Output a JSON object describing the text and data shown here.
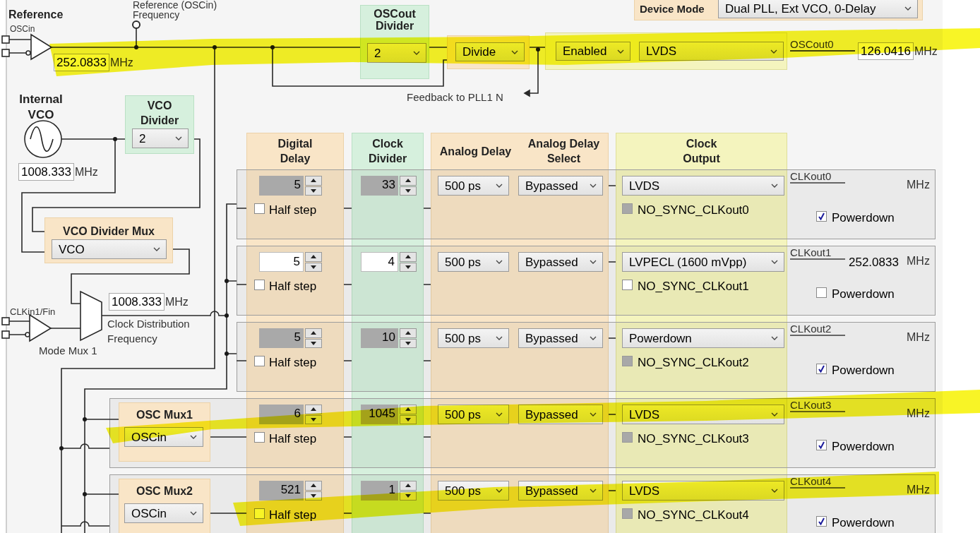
{
  "device_mode": {
    "label": "Device Mode",
    "value": "Dual PLL, Ext VCO, 0-Delay"
  },
  "reference": {
    "title": "Reference",
    "input": "OSCin",
    "probe_label": [
      "Reference (OSCin)",
      "Frequency"
    ],
    "frequency": "252.0833",
    "unit": "MHz"
  },
  "oscout_divider": {
    "title": "OSCout Divider",
    "value": "2"
  },
  "oscout_mux": {
    "value": "Divide"
  },
  "feedback_label": "Feedback to PLL1 N",
  "oscout": {
    "enable": "Enabled",
    "format": "LVDS",
    "name": "OSCout0",
    "frequency": "126.0416",
    "unit": "MHz"
  },
  "internal_vco": {
    "title": "Internal VCO",
    "frequency": "1008.333",
    "unit": "MHz"
  },
  "vco_divider": {
    "title": "VCO Divider",
    "value": "2"
  },
  "vco_divider_mux": {
    "title": "VCO Divider Mux",
    "value": "VCO"
  },
  "mode_mux": {
    "input": "CLKin1/Fin",
    "title": "Mode Mux 1",
    "frequency": "1008.333",
    "unit": "MHz",
    "frequency_label": [
      "Clock Distribution",
      "Frequency"
    ]
  },
  "columns": [
    {
      "labels": [
        "Digital Delay"
      ],
      "kind": "delay"
    },
    {
      "labels": [
        "Clock Divider"
      ],
      "kind": "divider"
    },
    {
      "labels": [
        "Analog Delay",
        "Analog Delay Select"
      ],
      "kind": "delay"
    },
    {
      "labels": [
        "Clock Output"
      ],
      "kind": "output"
    }
  ],
  "rows": [
    {
      "digital_delay": "5",
      "clock_divider": "33",
      "half_step_label": "Half step",
      "half_step": false,
      "analog_delay": "500 ps",
      "analog_select": "Bypassed",
      "format": "LVDS",
      "no_sync_label": "NO_SYNC_CLKout0",
      "disabled": true,
      "name": "CLKout0",
      "unit": "MHz",
      "powerdown_label": "Powerdown",
      "powerdown": true
    },
    {
      "digital_delay": "5",
      "clock_divider": "4",
      "half_step_label": "Half step",
      "half_step": false,
      "analog_delay": "500 ps",
      "analog_select": "Bypassed",
      "format": "LVPECL (1600 mVpp)",
      "no_sync_label": "NO_SYNC_CLKout1",
      "disabled": false,
      "name": "CLKout1",
      "frequency": "252.0833",
      "unit": "MHz",
      "powerdown_label": "Powerdown",
      "powerdown": false
    },
    {
      "digital_delay": "5",
      "clock_divider": "10",
      "half_step_label": "Half step",
      "half_step": false,
      "analog_delay": "500 ps",
      "analog_select": "Bypassed",
      "format": "Powerdown",
      "no_sync_label": "NO_SYNC_CLKout2",
      "disabled": true,
      "name": "CLKout2",
      "unit": "MHz",
      "powerdown_label": "Powerdown",
      "powerdown": true
    },
    {
      "osc_mux": {
        "title": "OSC Mux1",
        "value": "OSCin"
      },
      "digital_delay": "6",
      "clock_divider": "1045",
      "half_step_label": "Half step",
      "half_step": false,
      "analog_delay": "500 ps",
      "analog_select": "Bypassed",
      "format": "LVDS",
      "no_sync_label": "NO_SYNC_CLKout3",
      "disabled": true,
      "name": "CLKout3",
      "unit": "MHz",
      "powerdown_label": "Powerdown",
      "powerdown": true
    },
    {
      "osc_mux": {
        "title": "OSC Mux2",
        "value": "OSCin"
      },
      "digital_delay": "521",
      "clock_divider": "1",
      "half_step_label": "Half step",
      "half_step": false,
      "analog_delay": "500 ps",
      "analog_select": "Bypassed",
      "format": "LVDS",
      "no_sync_label": "NO_SYNC_CLKout4",
      "disabled": true,
      "name": "CLKout4",
      "unit": "MHz",
      "powerdown_label": "Powerdown",
      "powerdown": true
    }
  ]
}
